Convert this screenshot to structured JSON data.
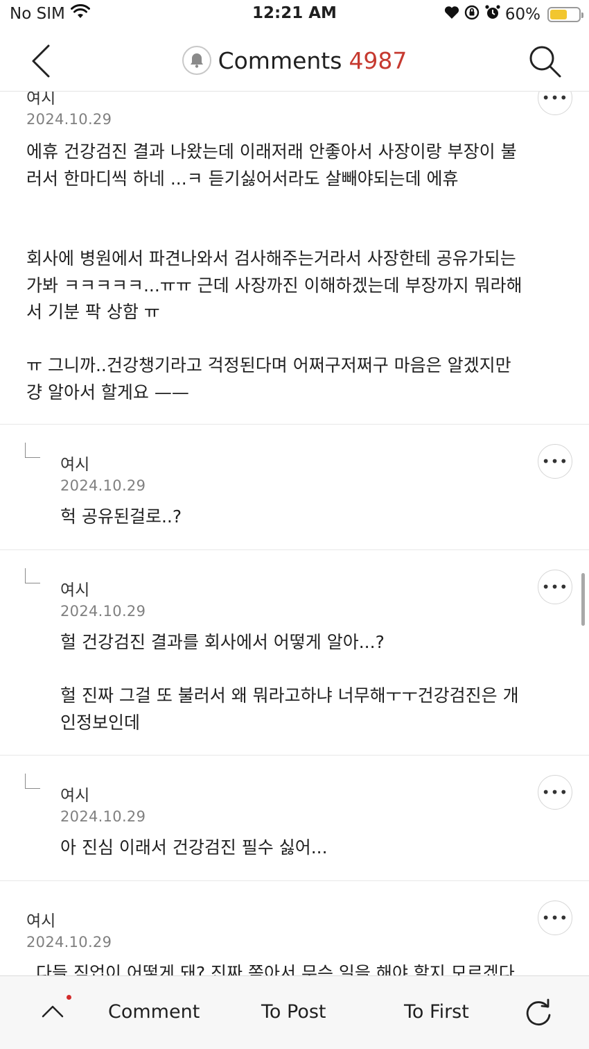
{
  "status_bar": {
    "carrier": "No SIM",
    "time": "12:21 AM",
    "battery": "60%",
    "battery_level": 0.6,
    "icons": [
      "wifi-icon",
      "heart-icon",
      "orientation-lock-icon",
      "alarm-icon",
      "battery-icon"
    ]
  },
  "nav": {
    "title": "Comments",
    "count": "4987",
    "count_color": "#c63a30",
    "icons": [
      "back-chevron-icon",
      "bell-icon",
      "search-icon"
    ]
  },
  "comments": [
    {
      "author": "여시",
      "date": "2024.10.29",
      "reply": false,
      "body": "에휴 건강검진 결과 나왔는데 이래저래 안좋아서 사장이랑 부장이 불\n러서 한마디씩 하네 ...ㅋ 듣기싫어서라도 살빼야되는데 에휴\n\n\n회사에 병원에서 파견나와서 검사해주는거라서 사장한테 공유가되는\n가봐 ㅋㅋㅋㅋㅋ...ㅠㅠ 근데 사장까진 이해하겠는데 부장까지 뭐라해\n서 기분 팍 상함 ㅠ\n\nㅠ 그니까..건강챙기라고 걱정된다며 어쩌구저쩌구 마음은 알겠지만\n걍 알아서 할게요 ——"
    },
    {
      "author": "여시",
      "date": "2024.10.29",
      "reply": true,
      "body": "헉 공유된걸로..?"
    },
    {
      "author": "여시",
      "date": "2024.10.29",
      "reply": true,
      "body": "헐 건강검진 결과를 회사에서 어떻게 알아...?\n\n헐 진짜 그걸 또 불러서 왜 뭐라고하냐 너무해ㅜㅜ건강검진은 개\n인정보인데"
    },
    {
      "author": "여시",
      "date": "2024.10.29",
      "reply": true,
      "body": "아 진심 이래서 건강검진 필수 싫어..."
    },
    {
      "author": "여시",
      "date": "2024.10.29",
      "reply": false,
      "body": "다들 직업이 어떻게 돼? 진짜 쫒아서 무슨 일을 해야 할지 모르겠다"
    }
  ],
  "more_label": "•••",
  "toolbar": {
    "comment": "Comment",
    "to_post": "To Post",
    "to_first": "To First",
    "icons": [
      "chevron-up-icon",
      "notification-dot",
      "refresh-icon"
    ],
    "dot_color": "#d22c2c"
  }
}
